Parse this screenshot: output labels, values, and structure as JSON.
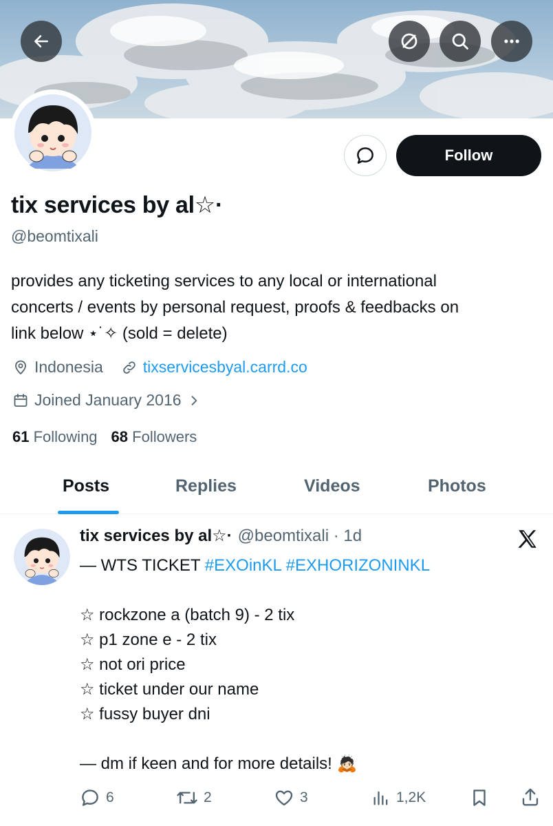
{
  "profile": {
    "display_name": "tix services by al☆·",
    "handle": "@beomtixali",
    "bio_lines": [
      "provides any ticketing services to any local or international",
      "concerts / events by personal request, proofs & feedbacks on",
      "link below ⋆˙✧ (sold = delete)"
    ],
    "location": "Indonesia",
    "website": "tixservicesbyal.carrd.co",
    "joined": "Joined January 2016",
    "following_count": "61",
    "following_label": "Following",
    "followers_count": "68",
    "followers_label": "Followers"
  },
  "actions": {
    "follow_label": "Follow"
  },
  "tabs": [
    {
      "label": "Posts",
      "active": true
    },
    {
      "label": "Replies",
      "active": false
    },
    {
      "label": "Videos",
      "active": false
    },
    {
      "label": "Photos",
      "active": false
    }
  ],
  "post": {
    "author_name": "tix services by al☆·",
    "author_meta": "@beomtixali · 1d",
    "line1_prefix": "— WTS TICKET ",
    "hashtag1": "#EXOinKL",
    "hashtag2": "#EXHORIZONINKL",
    "items": [
      "☆ rockzone a (batch 9) - 2 tix",
      "☆ p1 zone e - 2 tix",
      "☆ not ori price",
      "☆ ticket under our name",
      "☆ fussy buyer dni"
    ],
    "closing": "— dm if keen and for more details! 🙇🏻",
    "replies": "6",
    "reposts": "2",
    "likes": "3",
    "views": "1,2K"
  },
  "colors": {
    "accent": "#1d9bf0",
    "text": "#0f1419",
    "secondary": "#536471"
  }
}
